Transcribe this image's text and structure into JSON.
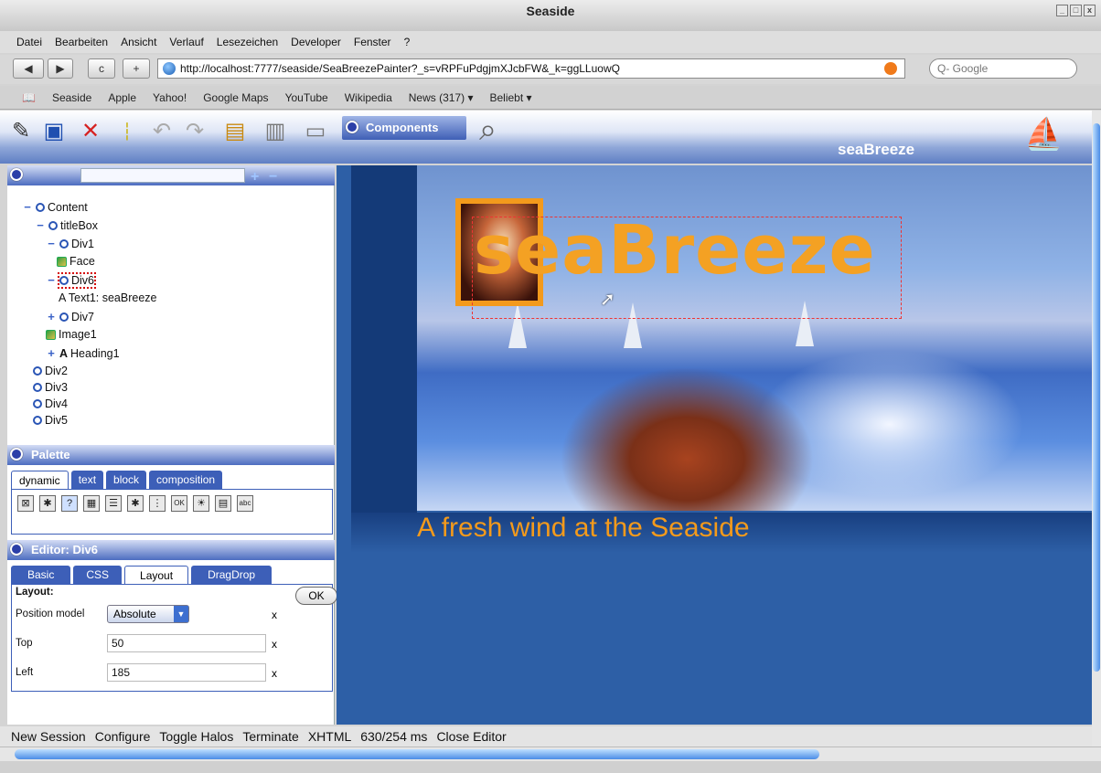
{
  "window": {
    "title": "Seaside",
    "controls": [
      "_",
      "□",
      "x"
    ]
  },
  "menu": [
    "Datei",
    "Bearbeiten",
    "Ansicht",
    "Verlauf",
    "Lesezeichen",
    "Developer",
    "Fenster",
    "?"
  ],
  "nav": {
    "back": "◀",
    "forward": "▶",
    "reload": "c",
    "add": "+",
    "url": "http://localhost:7777/seaside/SeaBreezePainter?_s=vRPFuPdgjmXJcbFW&_k=ggLLuowQ",
    "search_placeholder": "Q- Google"
  },
  "bookmarks": [
    "Seaside",
    "Apple",
    "Yahoo!",
    "Google Maps",
    "YouTube",
    "Wikipedia",
    "News (317) ▾",
    "Beliebt ▾"
  ],
  "bookmark_icon": "📖",
  "app": {
    "components_label": "Components",
    "brand": "seaBreeze"
  },
  "tree": {
    "nodes": [
      {
        "label": "Content"
      },
      {
        "label": "titleBox"
      },
      {
        "label": "Div1"
      },
      {
        "label": "Face"
      },
      {
        "label": "Div6"
      },
      {
        "label": "A Text1: seaBreeze"
      },
      {
        "label": "Div7"
      },
      {
        "label": "Image1"
      },
      {
        "label": "Heading1"
      },
      {
        "label": "Div2"
      },
      {
        "label": "Div3"
      },
      {
        "label": "Div4"
      },
      {
        "label": "Div5"
      }
    ]
  },
  "palette": {
    "title": "Palette",
    "tabs": [
      "dynamic",
      "text",
      "block",
      "composition"
    ]
  },
  "editor": {
    "title": "Editor: Div6",
    "tabs": [
      "Basic",
      "CSS",
      "Layout",
      "DragDrop"
    ],
    "section": "Layout:",
    "position_label": "Position model",
    "position_value": "Absolute",
    "top_label": "Top",
    "top_value": "50",
    "left_label": "Left",
    "left_value": "185",
    "x": "x",
    "ok": "OK"
  },
  "canvas": {
    "hero_title": "seaBreeze",
    "slogan": "A fresh wind at the Seaside"
  },
  "status": [
    "New Session",
    "Configure",
    "Toggle Halos",
    "Terminate",
    "XHTML",
    "630/254 ms",
    "Close Editor"
  ],
  "colors": {
    "accent": "#3d5fb8",
    "brand_orange": "#f39a1c"
  }
}
